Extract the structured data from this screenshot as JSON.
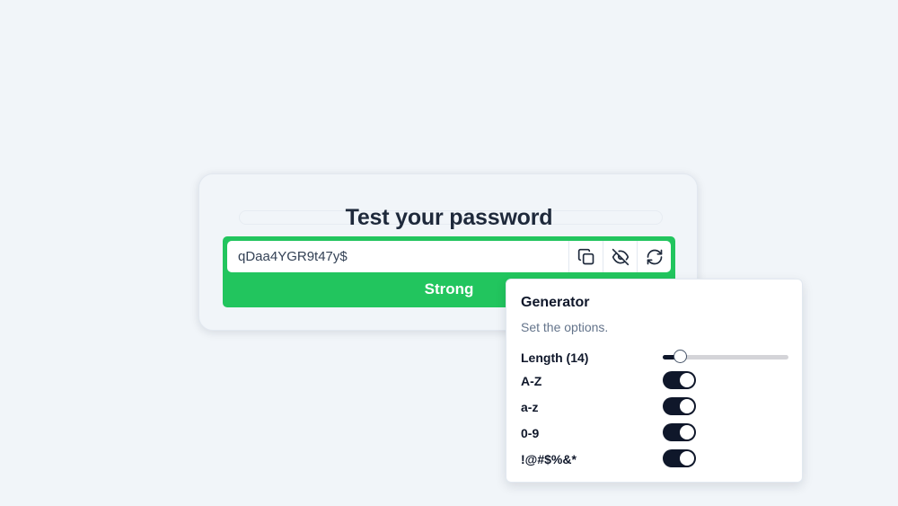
{
  "card": {
    "title": "Test your password",
    "password_value": "qDaa4YGR9t47y$",
    "strength_label": "Strong"
  },
  "icons": {
    "copy": "copy-icon",
    "visibility": "eye-off-icon",
    "regenerate": "refresh-icon"
  },
  "generator": {
    "title": "Generator",
    "subtitle": "Set the options.",
    "length_label": "Length (14)",
    "length_value": 14,
    "length_fraction": 0.14,
    "options": [
      {
        "label": "A-Z",
        "enabled": true
      },
      {
        "label": "a-z",
        "enabled": true
      },
      {
        "label": "0-9",
        "enabled": true
      },
      {
        "label": "!@#$%&*",
        "enabled": true
      }
    ]
  },
  "colors": {
    "strong": "#22c55e",
    "toggle_on": "#0f172a",
    "background": "#f1f5f9"
  }
}
